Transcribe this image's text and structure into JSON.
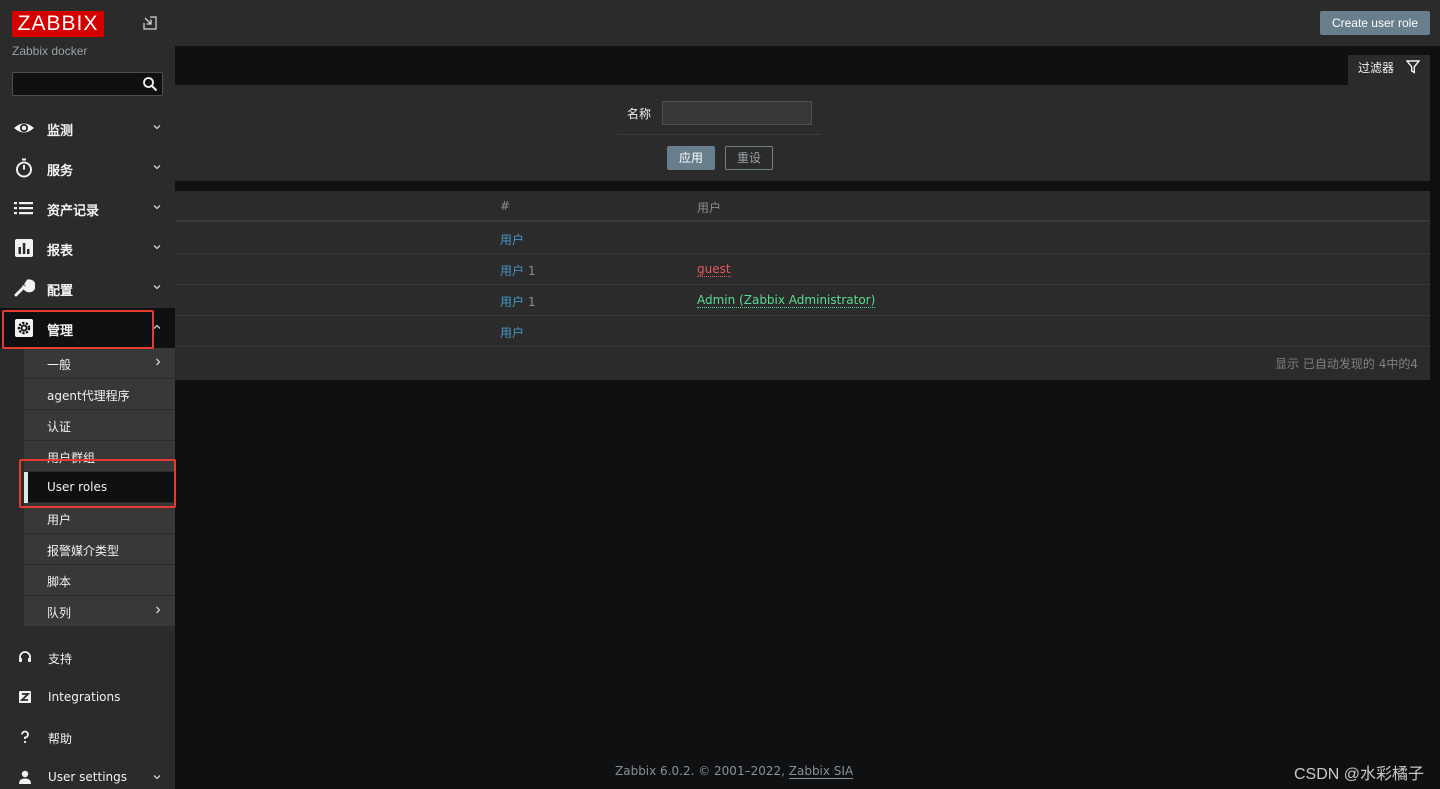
{
  "header": {
    "create_button": "Create user role"
  },
  "filter": {
    "tab_label": "过滤器",
    "name_label": "名称",
    "name_value": "",
    "apply_label": "应用",
    "reset_label": "重设"
  },
  "table": {
    "columns": [
      "#",
      "用户"
    ],
    "rows": [
      {
        "users_link": "用户",
        "count": "",
        "user": "",
        "user_status": "none"
      },
      {
        "users_link": "用户",
        "count": "1",
        "user": "guest",
        "user_status": "disabled"
      },
      {
        "users_link": "用户",
        "count": "1",
        "user": "Admin (Zabbix Administrator)",
        "user_status": "enabled"
      },
      {
        "users_link": "用户",
        "count": "",
        "user": "",
        "user_status": "none"
      }
    ],
    "footer": "显示 已自动发现的 4中的4"
  },
  "sidebar": {
    "logo": "ZABBIX",
    "server_name": "Zabbix docker",
    "search_value": "",
    "menu": [
      {
        "label": "监测",
        "icon": "eye-icon"
      },
      {
        "label": "服务",
        "icon": "stopwatch-icon"
      },
      {
        "label": "资产记录",
        "icon": "list-icon"
      },
      {
        "label": "报表",
        "icon": "bar-chart-icon"
      },
      {
        "label": "配置",
        "icon": "wrench-icon"
      },
      {
        "label": "管理",
        "icon": "gear-icon"
      }
    ],
    "submenu": [
      {
        "label": "一般",
        "has_arrow": true
      },
      {
        "label": "agent代理程序",
        "has_arrow": false
      },
      {
        "label": "认证",
        "has_arrow": false
      },
      {
        "label": "用户群组",
        "has_arrow": false
      },
      {
        "label": "User roles",
        "has_arrow": false
      },
      {
        "label": "用户",
        "has_arrow": false
      },
      {
        "label": "报警媒介类型",
        "has_arrow": false
      },
      {
        "label": "脚本",
        "has_arrow": false
      },
      {
        "label": "队列",
        "has_arrow": true
      }
    ],
    "bottom": [
      {
        "label": "支持",
        "icon": "headset-icon"
      },
      {
        "label": "Integrations",
        "icon": "integrations-icon"
      },
      {
        "label": "帮助",
        "icon": "help-icon"
      },
      {
        "label": "User settings",
        "icon": "user-icon"
      }
    ]
  },
  "footer": {
    "copyright": "Zabbix 6.0.2. © 2001–2022, ",
    "company": "Zabbix SIA"
  },
  "watermark": "CSDN @水彩橘子",
  "colors": {
    "accent": "#687e8c",
    "link": "#4796c4",
    "disabled_user": "#e45959",
    "enabled_user": "#59db8f",
    "logo_red": "#d40000",
    "highlight_red": "#e53b32"
  }
}
